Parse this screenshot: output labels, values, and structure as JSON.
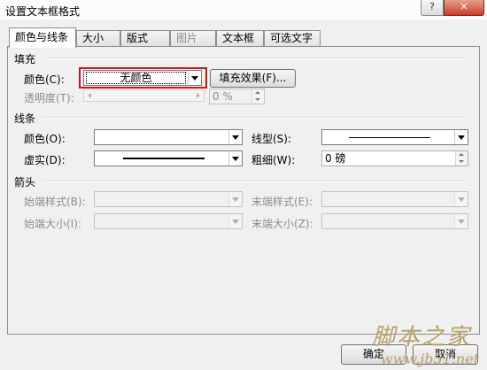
{
  "window": {
    "title": "设置文本框格式",
    "help": "?",
    "close": "✕"
  },
  "tabs": [
    {
      "label": "颜色与线条"
    },
    {
      "label": "大小"
    },
    {
      "label": "版式"
    },
    {
      "label": "图片"
    },
    {
      "label": "文本框"
    },
    {
      "label": "可选文字"
    }
  ],
  "fill": {
    "heading": "填充",
    "color_label": "颜色(C):",
    "color_value": "无颜色",
    "effects_button": "填充效果(F)...",
    "transparency_label": "透明度(T):",
    "transparency_value": "0 %"
  },
  "line": {
    "heading": "线条",
    "color_label": "颜色(O):",
    "style_label": "线型(S):",
    "dash_label": "虚实(D):",
    "weight_label": "粗细(W):",
    "weight_value": "0 磅"
  },
  "arrows": {
    "heading": "箭头",
    "begin_style_label": "始端样式(B):",
    "end_style_label": "末端样式(E):",
    "begin_size_label": "始端大小(I):",
    "end_size_label": "末端大小(Z):"
  },
  "buttons": {
    "ok": "确定",
    "cancel": "取消"
  },
  "watermark": {
    "line1": "脚本之家",
    "line2": "www.jb51.net"
  },
  "colors": {
    "highlight": "#d0141c",
    "watermark": "#b8a06a"
  }
}
